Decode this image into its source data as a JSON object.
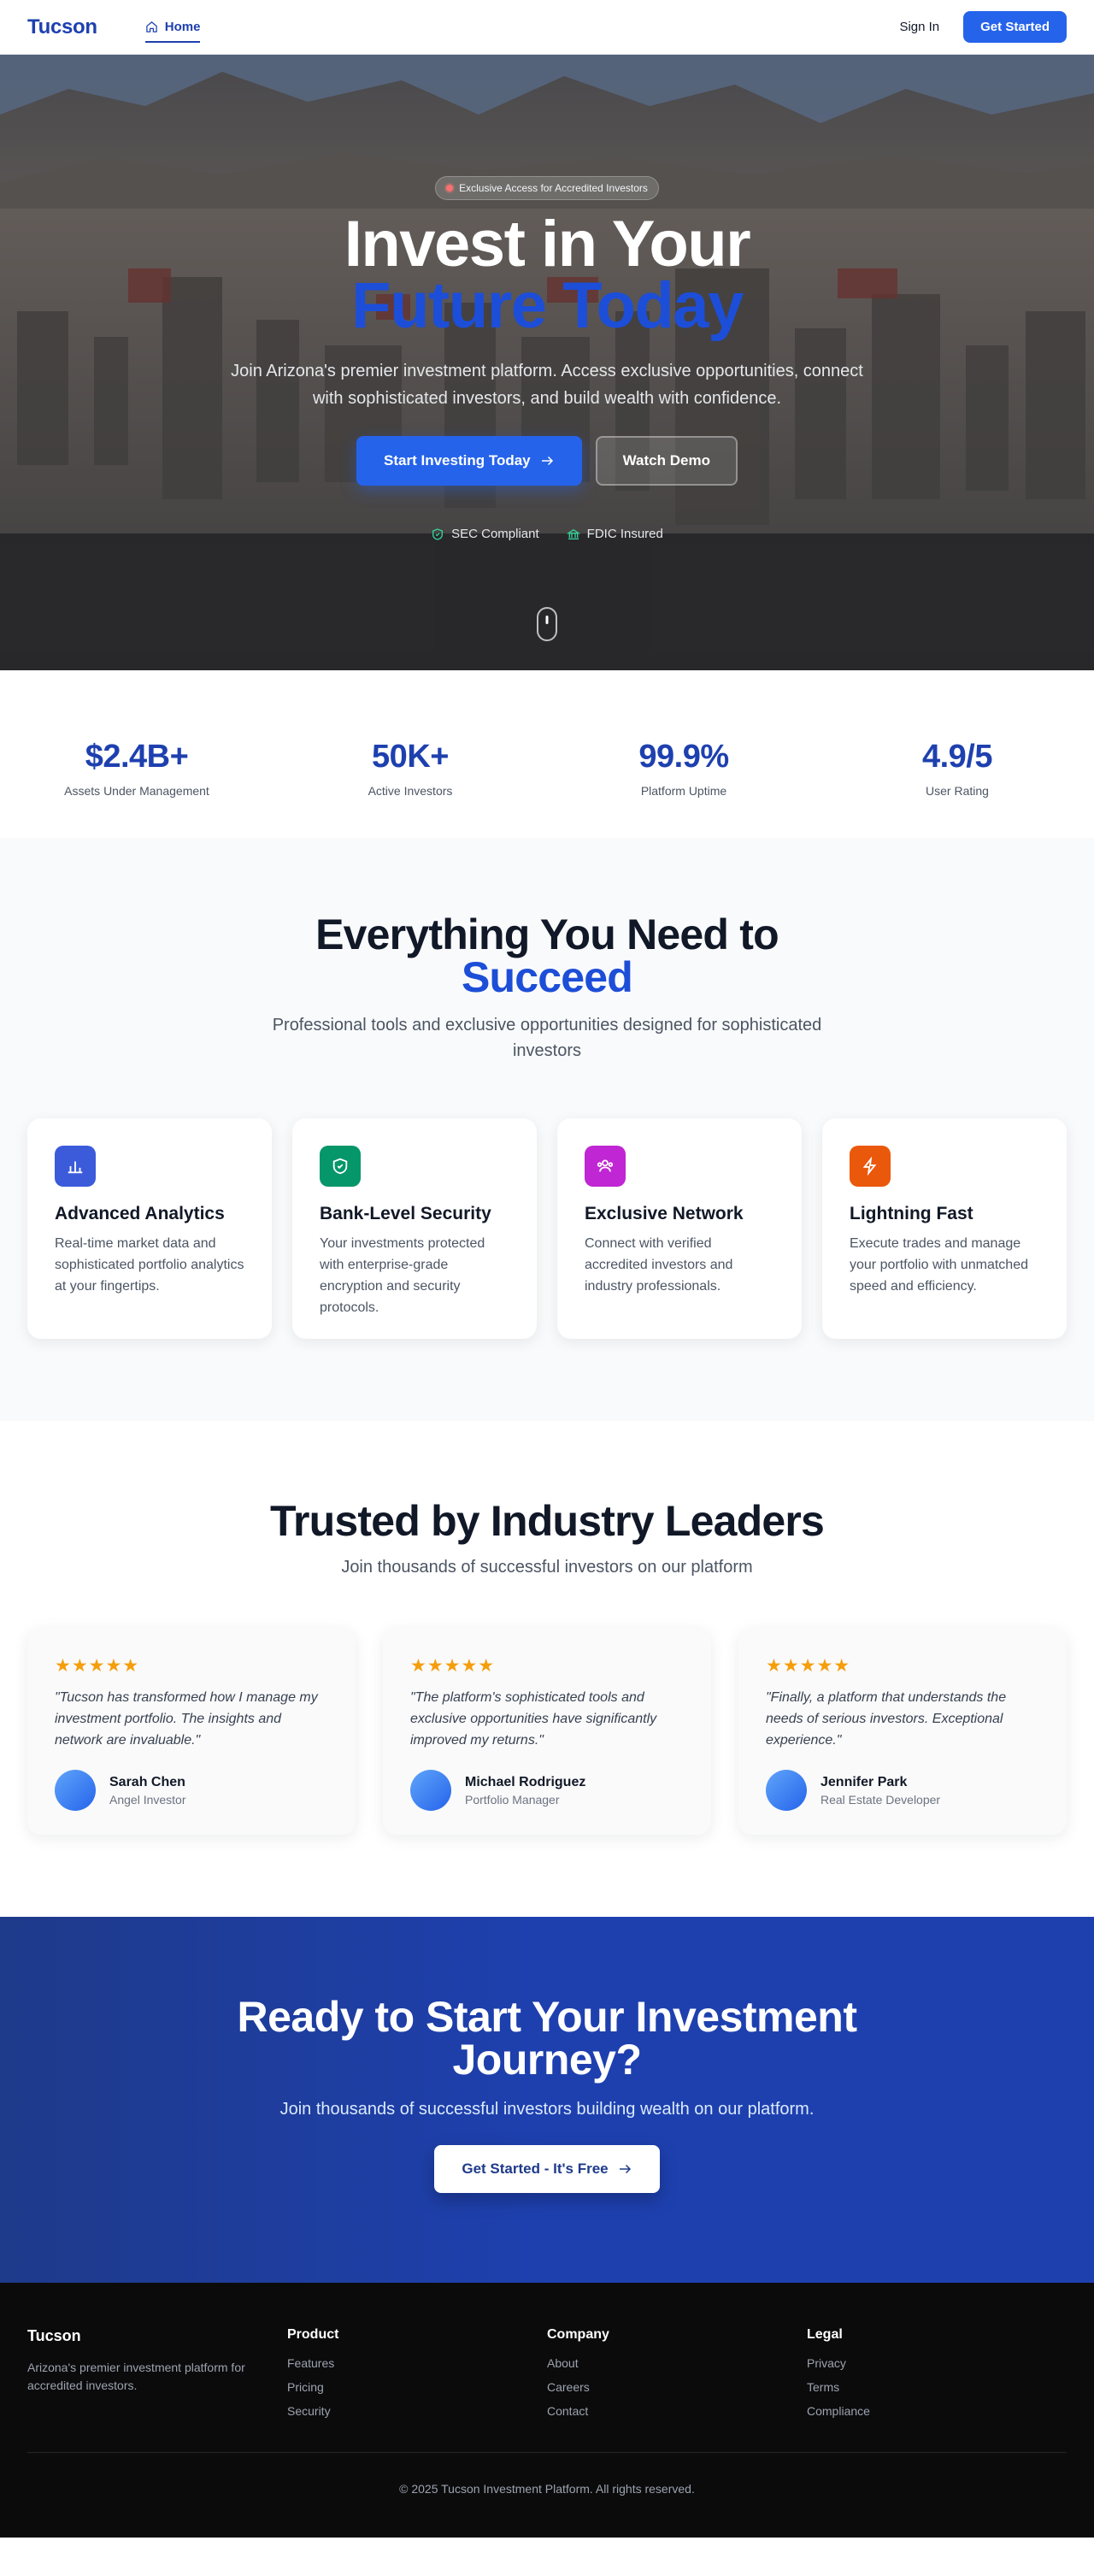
{
  "nav": {
    "brand": "Tucson",
    "home_label": "Home",
    "signin_label": "Sign In",
    "cta_label": "Get Started"
  },
  "hero": {
    "badge": "Exclusive Access for Accredited Investors",
    "title_line1": "Invest in Your",
    "title_line2": "Future Today",
    "subtitle": "Join Arizona's premier investment platform. Access exclusive opportunities, connect with sophisticated investors, and build wealth with confidence.",
    "primary_cta": "Start Investing Today",
    "secondary_cta": "Watch Demo",
    "trust": [
      "SEC Compliant",
      "FDIC Insured"
    ]
  },
  "stats": [
    {
      "value": "$2.4B+",
      "label": "Assets Under Management"
    },
    {
      "value": "50K+",
      "label": "Active Investors"
    },
    {
      "value": "99.9%",
      "label": "Platform Uptime"
    },
    {
      "value": "4.9/5",
      "label": "User Rating"
    }
  ],
  "features": {
    "title_line1": "Everything You Need to",
    "title_line2": "Succeed",
    "subtitle": "Professional tools and exclusive opportunities designed for sophisticated investors",
    "cards": [
      {
        "icon": "bar-chart-icon",
        "color": "#3b5bdb",
        "title": "Advanced Analytics",
        "text": "Real-time market data and sophisticated portfolio analytics at your fingertips."
      },
      {
        "icon": "shield-icon",
        "color": "#059669",
        "title": "Bank-Level Security",
        "text": "Your investments protected with enterprise-grade encryption and security protocols."
      },
      {
        "icon": "users-icon",
        "color": "#c026d3",
        "title": "Exclusive Network",
        "text": "Connect with verified accredited investors and industry professionals."
      },
      {
        "icon": "lightning-icon",
        "color": "#ea580c",
        "title": "Lightning Fast",
        "text": "Execute trades and manage your portfolio with unmatched speed and efficiency."
      }
    ]
  },
  "testimonials": {
    "title": "Trusted by Industry Leaders",
    "subtitle": "Join thousands of successful investors on our platform",
    "rating": 5,
    "items": [
      {
        "quote": "\"Tucson has transformed how I manage my investment portfolio. The insights and network are invaluable.\"",
        "name": "Sarah Chen",
        "role": "Angel Investor"
      },
      {
        "quote": "\"The platform's sophisticated tools and exclusive opportunities have significantly improved my returns.\"",
        "name": "Michael Rodriguez",
        "role": "Portfolio Manager"
      },
      {
        "quote": "\"Finally, a platform that understands the needs of serious investors. Exceptional experience.\"",
        "name": "Jennifer Park",
        "role": "Real Estate Developer"
      }
    ]
  },
  "cta": {
    "title": "Ready to Start Your Investment Journey?",
    "subtitle": "Join thousands of successful investors building wealth on our platform.",
    "button": "Get Started - It's Free"
  },
  "footer": {
    "brand": "Tucson",
    "description": "Arizona's premier investment platform for accredited investors.",
    "columns": [
      {
        "heading": "Product",
        "links": [
          "Features",
          "Pricing",
          "Security"
        ]
      },
      {
        "heading": "Company",
        "links": [
          "About",
          "Careers",
          "Contact"
        ]
      },
      {
        "heading": "Legal",
        "links": [
          "Privacy",
          "Terms",
          "Compliance"
        ]
      }
    ],
    "copyright": "© 2025 Tucson Investment Platform. All rights reserved."
  },
  "colors": {
    "accent": "#2563eb",
    "brand": "#1e40af",
    "star": "#f59e0b"
  }
}
